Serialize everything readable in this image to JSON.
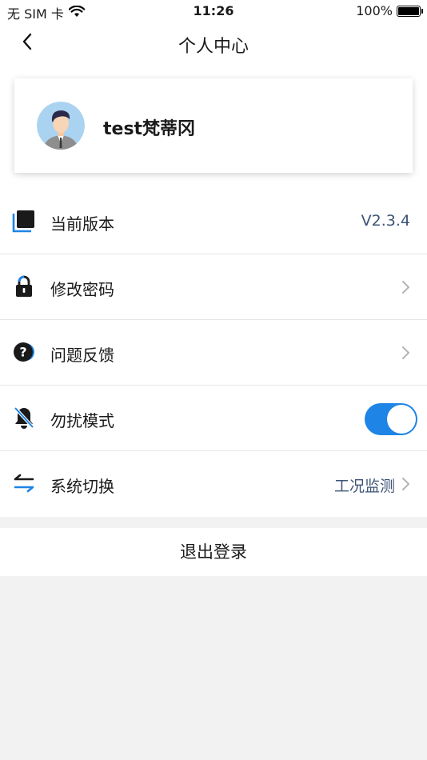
{
  "status_bar": {
    "carrier": "无 SIM 卡",
    "time": "11:26",
    "battery_text": "100%",
    "battery_level": 1.0
  },
  "nav": {
    "title": "个人中心",
    "back_icon": "chevron-left-icon"
  },
  "profile": {
    "name": "test梵蒂冈",
    "avatar_icon": "avatar-icon"
  },
  "menu": {
    "version": {
      "label": "当前版本",
      "value": "V2.3.4",
      "icon": "version-icon"
    },
    "password": {
      "label": "修改密码",
      "icon": "lock-icon"
    },
    "feedback": {
      "label": "问题反馈",
      "icon": "question-icon"
    },
    "dnd": {
      "label": "勿扰模式",
      "icon": "bell-off-icon",
      "enabled": true
    },
    "system": {
      "label": "系统切换",
      "value": "工况监测",
      "icon": "switch-arrows-icon"
    }
  },
  "logout_label": "退出登录",
  "colors": {
    "accent": "#1e84e6",
    "value_text": "#3e5477",
    "background": "#f2f2f2"
  }
}
